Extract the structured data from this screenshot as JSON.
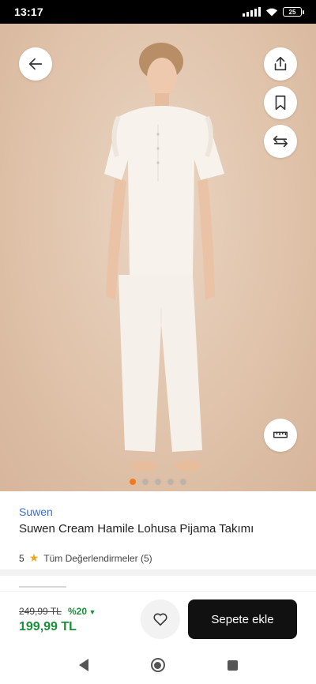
{
  "status_bar": {
    "time": "13:17",
    "battery": "25"
  },
  "product": {
    "brand": "Suwen",
    "title": "Suwen Cream Hamile Lohusa Pijama Takımı",
    "rating_value": "5",
    "reviews_label": "Tüm Değerlendirmeler (5)",
    "image_count": 5,
    "active_image_index": 0
  },
  "pricing": {
    "old_price": "249,99 TL",
    "discount": "%20",
    "new_price": "199,99 TL"
  },
  "actions": {
    "add_to_cart_label": "Sepete ekle"
  },
  "icons": {
    "back": "arrow-left-icon",
    "share": "share-icon",
    "bookmark": "bookmark-icon",
    "compare": "swap-arrows-icon",
    "size_guide": "ruler-icon",
    "favorite": "heart-icon",
    "star": "star-icon"
  },
  "colors": {
    "accent_orange": "#f27a1a",
    "brand_link": "#3b6fd1",
    "price_green": "#1b8e3a",
    "cart_button": "#111111"
  }
}
